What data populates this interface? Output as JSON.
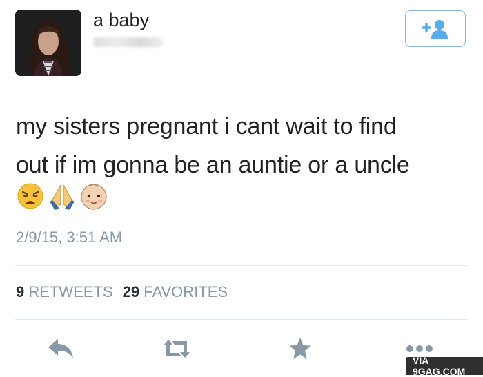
{
  "tweet": {
    "display_name": "a baby",
    "text_line1": "my sisters pregnant i cant wait to find",
    "text_line2": "out if im gonna be an auntie or a uncle",
    "emojis": [
      "weary-face-emoji",
      "folded-hands-emoji",
      "baby-emoji"
    ],
    "timestamp": "2/9/15, 3:51 AM",
    "retweets_count": "9",
    "retweets_label": "RETWEETS",
    "favorites_count": "29",
    "favorites_label": "FAVORITES"
  },
  "actions": [
    "reply-icon",
    "retweet-icon",
    "favorite-icon",
    "more-icon"
  ],
  "watermark": "VIA 9GAG.COM",
  "colors": {
    "icon": "#8899a6",
    "follow_accent": "#55acee",
    "text": "#222222"
  }
}
